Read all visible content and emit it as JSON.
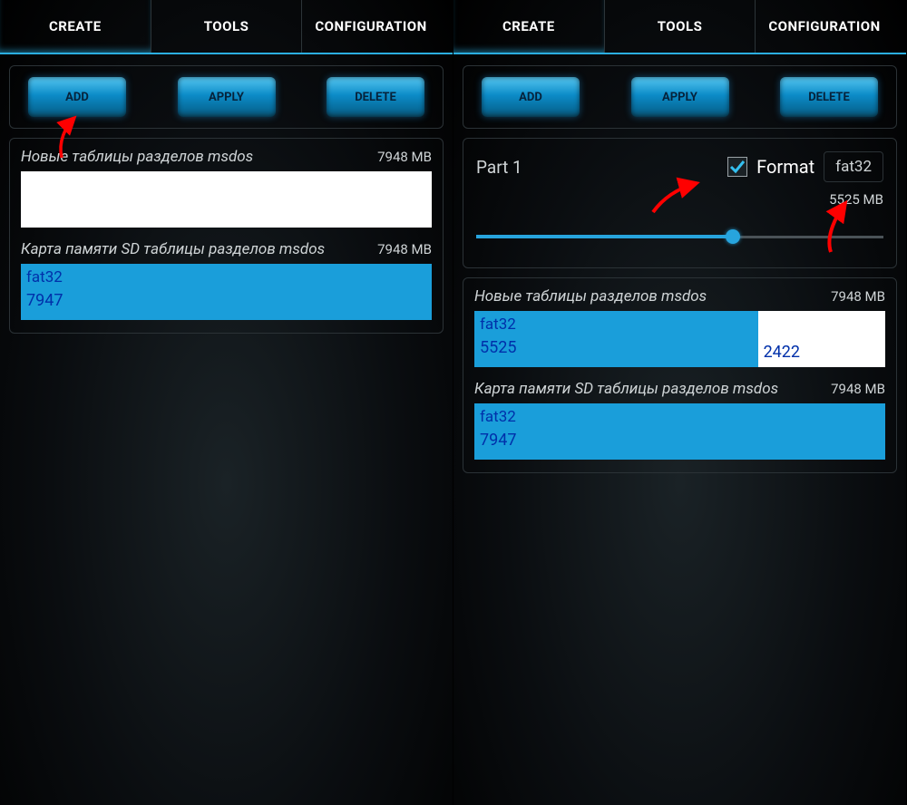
{
  "tabs": {
    "create": "CREATE",
    "tools": "TOOLS",
    "config": "CONFIGURATION"
  },
  "buttons": {
    "add": "ADD",
    "apply": "APPLY",
    "delete": "DELETE"
  },
  "left": {
    "section1": {
      "title": "Новые таблицы разделов msdos",
      "size": "7948 MB"
    },
    "section2": {
      "title": "Карта памяти SD таблицы разделов msdos",
      "size": "7948 MB",
      "part1_fs": "fat32",
      "part1_val": "7947"
    }
  },
  "right": {
    "part": {
      "label": "Part 1",
      "format_label": "Format",
      "fs_selected": "fat32",
      "selected_size": "5525 MB"
    },
    "section1": {
      "title": "Новые таблицы разделов msdos",
      "size": "7948 MB",
      "p1_fs": "fat32",
      "p1_val": "5525",
      "p2_val": "2422",
      "p1_width_pct": 69,
      "p2_width_pct": 31
    },
    "section2": {
      "title": "Карта памяти SD таблицы разделов msdos",
      "size": "7948 MB",
      "p1_fs": "fat32",
      "p1_val": "7947"
    }
  }
}
